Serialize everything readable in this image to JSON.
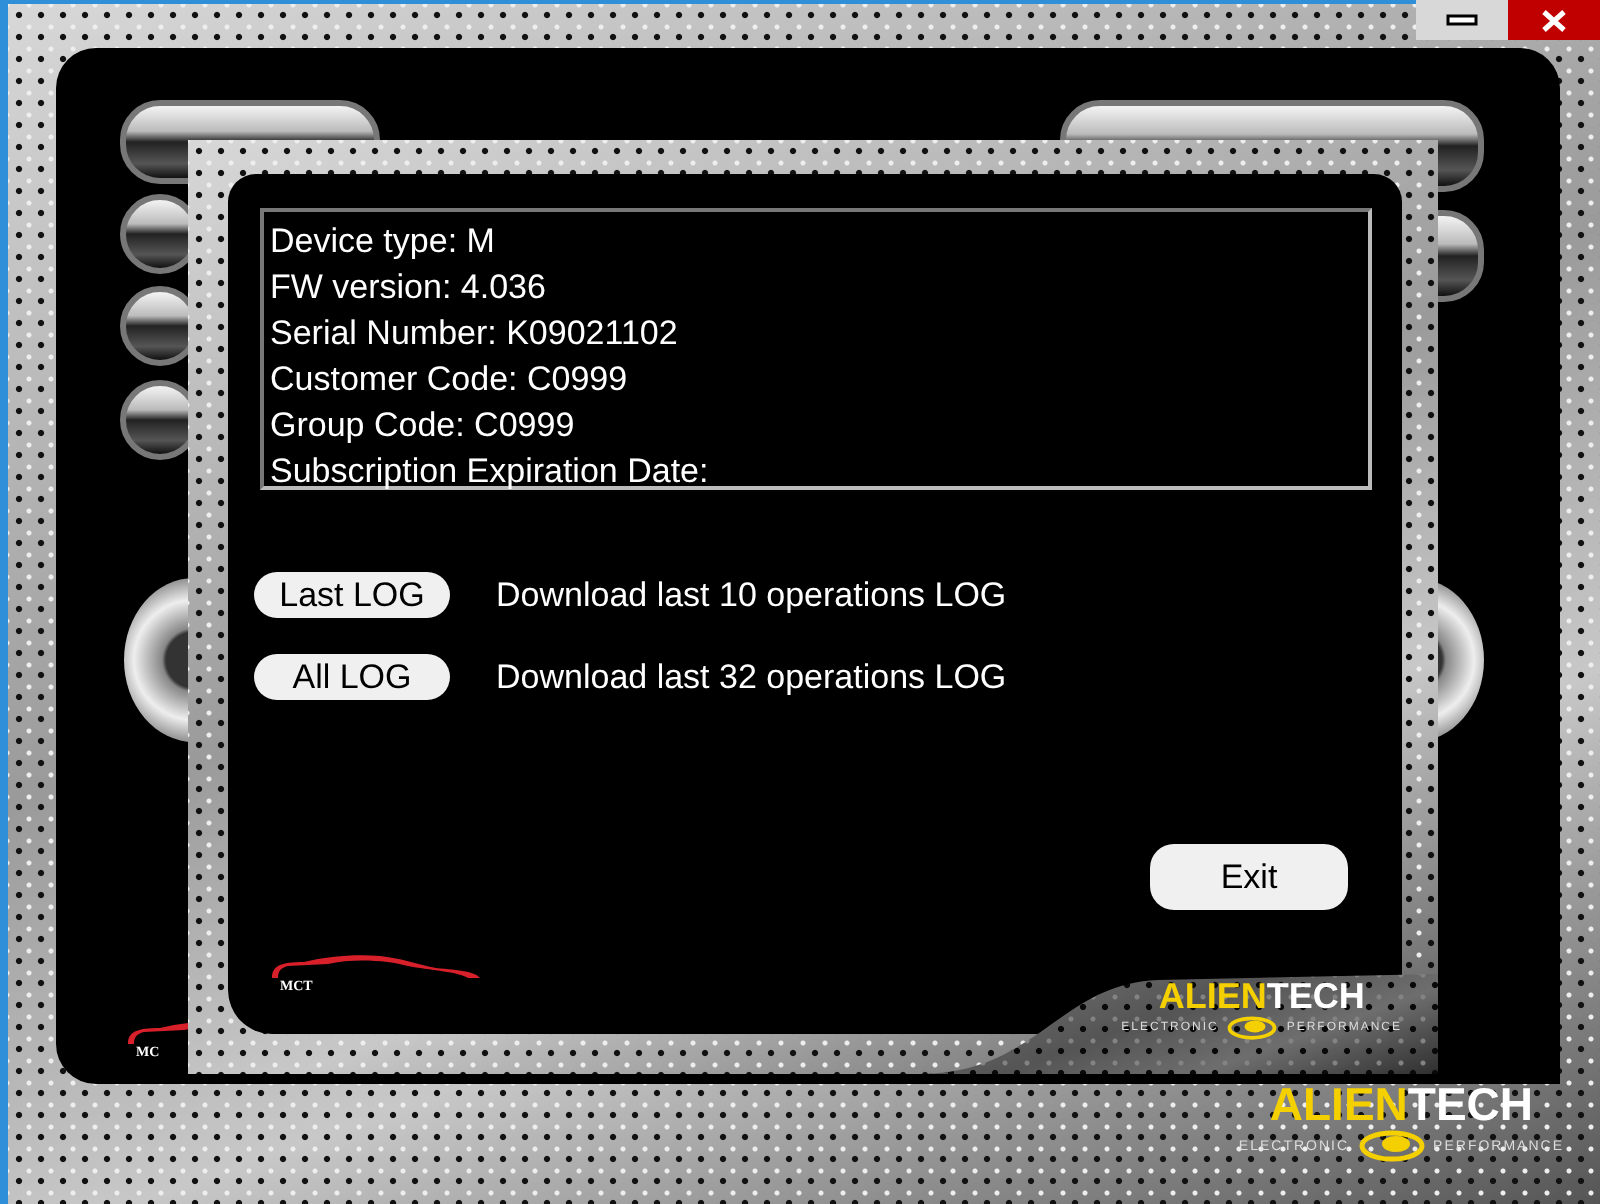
{
  "background_app": {
    "logo": {
      "accent": "ALIEN",
      "rest": "TECH",
      "left": "ELECTRONIC",
      "right": "PERFORMANCE"
    },
    "car_label": "MC"
  },
  "dialog": {
    "info_lines": [
      "Device type: M",
      "FW version: 4.036",
      "Serial Number: K09021102",
      "Customer Code: C0999",
      "Group Code: C0999",
      "Subscription Expiration Date:"
    ],
    "actions": [
      {
        "button": "Last LOG",
        "description": "Download last 10 operations LOG"
      },
      {
        "button": "All LOG",
        "description": "Download last 32 operations LOG"
      }
    ],
    "exit_button": "Exit",
    "car_label": "MCT",
    "logo": {
      "accent": "ALIEN",
      "rest": "TECH",
      "left": "ELECTRONIC",
      "right": "PERFORMANCE"
    }
  }
}
